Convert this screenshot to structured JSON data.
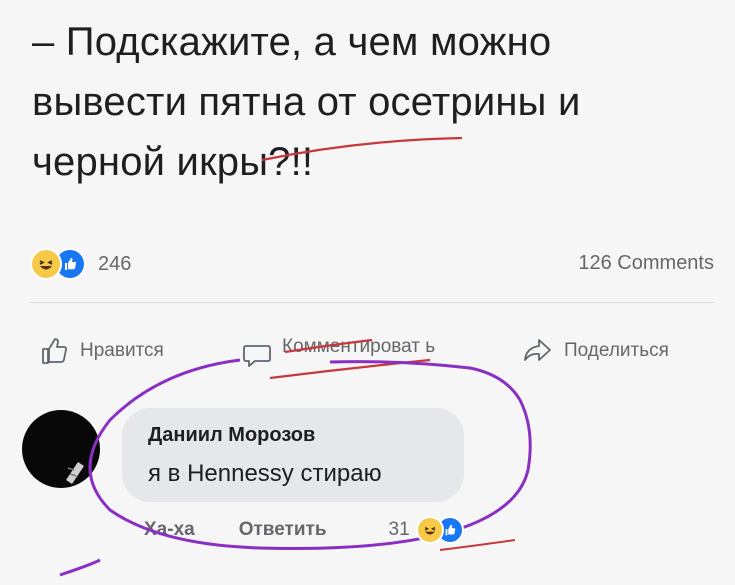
{
  "post": {
    "lines": [
      "– Подскажите, а чем можно",
      "вывести пятна от осетрины и",
      "черной икры?!!"
    ]
  },
  "stats": {
    "reactions_count": "246",
    "comments_count": "126 Comments",
    "reaction_icons": [
      "laughing-emoji",
      "like"
    ]
  },
  "actions": {
    "like": "Нравится",
    "comment": "Комментироват ь",
    "share": "Поделиться"
  },
  "comment": {
    "author": "Даниил Морозов",
    "text": "я в Hennessy стираю",
    "haha": "Ха-ха",
    "reply": "Ответить",
    "reactions_count": "31"
  },
  "colors": {
    "like_blue": "#1877f2",
    "emoji_yellow": "#f7c948",
    "underline_red": "#c8373a",
    "circle_purple": "#8a2fc4"
  }
}
